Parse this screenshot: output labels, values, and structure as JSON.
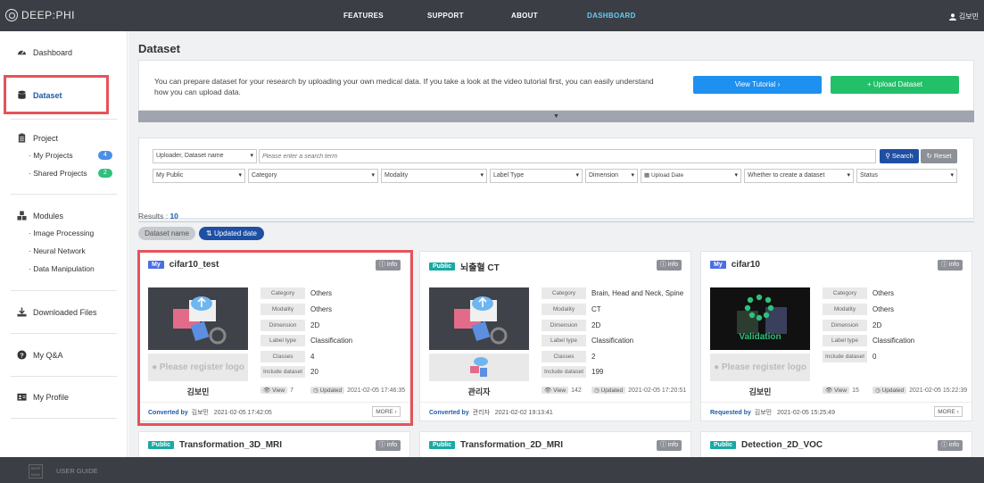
{
  "header": {
    "logo": "DEEP:PHI",
    "nav": [
      "FEATURES",
      "SUPPORT",
      "ABOUT",
      "DASHBOARD"
    ],
    "active_nav": "DASHBOARD",
    "user": "김보민"
  },
  "sidebar": {
    "dashboard": "Dashboard",
    "dataset": "Dataset",
    "project": "Project",
    "my_projects": "· My Projects",
    "my_projects_count": "4",
    "shared_projects": "· Shared Projects",
    "shared_projects_count": "2",
    "modules": "Modules",
    "image_processing": "· Image Processing",
    "neural_network": "· Neural Network",
    "data_manipulation": "· Data Manipulation",
    "downloaded_files": "Downloaded Files",
    "qa": "My Q&A",
    "profile": "My Profile"
  },
  "page": {
    "title": "Dataset",
    "description": "You can prepare dataset for your research by uploading your own medical data. If you take a look at the video tutorial first, you can easily understand how you can upload data.",
    "view_tutorial": "View Tutorial ›",
    "upload_dataset": "+ Upload Dataset"
  },
  "filters": {
    "search_type": "Uploader, Dataset name",
    "search_placeholder": "Please enter a search term",
    "search_button": "Search",
    "reset_button": "Reset",
    "my_public": "My Public",
    "category": "Category",
    "modality": "Modality",
    "label_type": "Label Type",
    "dimension": "Dimension",
    "upload_date": "Upload Date",
    "create_dataset": "Whether to create a dataset",
    "status": "Status"
  },
  "results": {
    "label": "Results : ",
    "count": "10",
    "sort_name": "Dataset name",
    "sort_date": "Updated date"
  },
  "labels": {
    "category": "Category",
    "modality": "Modality",
    "dimension": "Dimension",
    "label_type": "Label type",
    "classes": "Classes",
    "include_dataset": "Include dataset",
    "view": "View",
    "updated": "Updated",
    "info": "info",
    "more": "MORE ›",
    "register_logo": "Please register logo"
  },
  "cards": [
    {
      "tag": "My",
      "title": "cifar10_test",
      "category": "Others",
      "modality": "Others",
      "dimension": "2D",
      "label_type": "Classification",
      "classes": "4",
      "include_dataset": "20",
      "user": "김보민",
      "views": "7",
      "updated_date": "2021-02-05 17:46:35",
      "foot_label": "Converted by",
      "foot_user": "김보민",
      "foot_date": "2021-02-05 17:42:05"
    },
    {
      "tag": "Public",
      "title": "뇌출혈 CT",
      "category": "Brain, Head and Neck, Spine",
      "modality": "CT",
      "dimension": "2D",
      "label_type": "Classification",
      "classes": "2",
      "include_dataset": "199",
      "user": "관리자",
      "views": "142",
      "updated_date": "2021-02-05 17:20:51",
      "foot_label": "Converted by",
      "foot_user": "관리자",
      "foot_date": "2021-02-02 19:13:41"
    },
    {
      "tag": "My",
      "title": "cifar10",
      "category": "Others",
      "modality": "Others",
      "dimension": "2D",
      "label_type": "Classification",
      "classes": "",
      "include_dataset": "0",
      "user": "김보민",
      "views": "15",
      "updated_date": "2021-02-05 15:22:39",
      "foot_label": "Requested by",
      "foot_user": "김보민",
      "foot_date": "2021-02-05 15:25:49",
      "thumb_text": "Validation"
    }
  ],
  "cards_row2": [
    {
      "tag": "Public",
      "title": "Transformation_3D_MRI"
    },
    {
      "tag": "Public",
      "title": "Transformation_2D_MRI"
    },
    {
      "tag": "Public",
      "title": "Detection_2D_VOC"
    }
  ],
  "footer": {
    "logo": "DEEP NOID",
    "user_guide": "USER GUIDE"
  },
  "colors": {
    "nav_bg": "#3b3e45",
    "accent_blue": "#1e90f0",
    "accent_green": "#22c069",
    "highlight_red": "#e5535a",
    "tag_my": "#4b6ee3",
    "tag_public": "#1aa9a4"
  }
}
